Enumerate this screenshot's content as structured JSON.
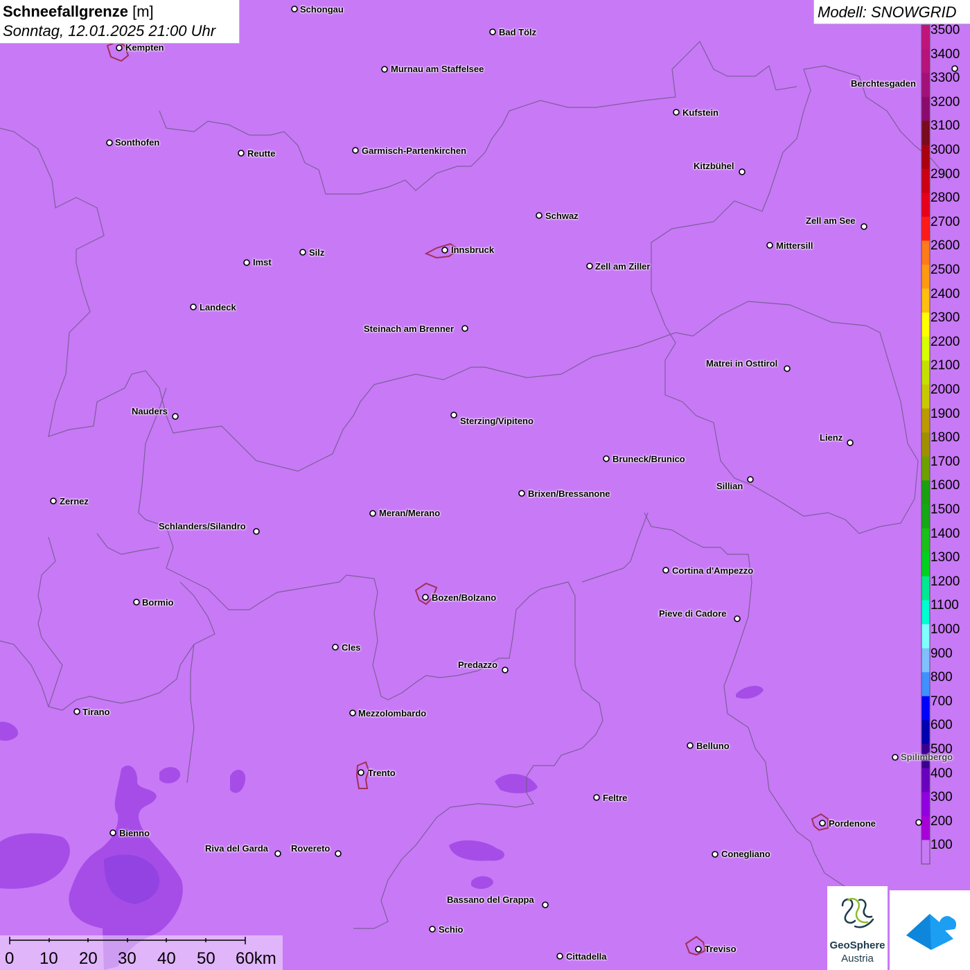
{
  "title": {
    "variable": "Schneefallgrenze",
    "unit": "[m]",
    "datetime": "Sonntag, 12.01.2025 21:00 Uhr"
  },
  "model": "Modell: SNOWGRID",
  "colors": {
    "background": "#c879f6",
    "low_snowline": "#a64de8",
    "lowest_snowline": "#8a3fe0",
    "city_boundary": "#a0305a"
  },
  "legend": {
    "labels": [
      "3500",
      "3400",
      "3300",
      "3200",
      "3100",
      "3000",
      "2900",
      "2800",
      "2700",
      "2600",
      "2500",
      "2400",
      "2300",
      "2200",
      "2100",
      "2000",
      "1900",
      "1800",
      "1700",
      "1600",
      "1500",
      "1400",
      "1300",
      "1200",
      "1100",
      "1000",
      "900",
      "800",
      "700",
      "600",
      "500",
      "400",
      "300",
      "200",
      "100"
    ],
    "colors": [
      "#c0147a",
      "#b8127c",
      "#a4107a",
      "#8c0a6e",
      "#7a0a1e",
      "#aa0010",
      "#cc0012",
      "#e8001a",
      "#ff1a1a",
      "#ff7a1a",
      "#ff9a10",
      "#ffbe10",
      "#ffff00",
      "#d8ff00",
      "#c4e000",
      "#c8c800",
      "#bc9a00",
      "#a09000",
      "#6ea000",
      "#1aa010",
      "#14a814",
      "#18c018",
      "#00d020",
      "#00e890",
      "#00ffd0",
      "#80ffff",
      "#80c0ff",
      "#4090ff",
      "#0000ff",
      "#0000b0",
      "#3a0090",
      "#6a00c0",
      "#9000e0",
      "#a800d8",
      "#c879f6"
    ]
  },
  "cities": [
    {
      "name": "Schongau"
    },
    {
      "name": "Kempten"
    },
    {
      "name": "Bad Tölz"
    },
    {
      "name": "Murnau am Staffelsee"
    },
    {
      "name": "Berchtesgaden"
    },
    {
      "name": "Kufstein"
    },
    {
      "name": "Sonthofen"
    },
    {
      "name": "Reutte"
    },
    {
      "name": "Garmisch-Partenkirchen"
    },
    {
      "name": "Kitzbühel"
    },
    {
      "name": "Schwaz"
    },
    {
      "name": "Zell am See"
    },
    {
      "name": "Mittersill"
    },
    {
      "name": "Innsbruck"
    },
    {
      "name": "Imst"
    },
    {
      "name": "Silz"
    },
    {
      "name": "Zell am Ziller"
    },
    {
      "name": "Landeck"
    },
    {
      "name": "Steinach am Brenner"
    },
    {
      "name": "Matrei in Osttirol"
    },
    {
      "name": "Nauders"
    },
    {
      "name": "Sterzing/Vipiteno"
    },
    {
      "name": "Lienz"
    },
    {
      "name": "Bruneck/Brunico"
    },
    {
      "name": "Sillian"
    },
    {
      "name": "Zernez"
    },
    {
      "name": "Brixen/Bressanone"
    },
    {
      "name": "Meran/Merano"
    },
    {
      "name": "Schlanders/Silandro"
    },
    {
      "name": "Cortina d'Ampezzo"
    },
    {
      "name": "Bozen/Bolzano"
    },
    {
      "name": "Bormio"
    },
    {
      "name": "Pieve di Cadore"
    },
    {
      "name": "Cles"
    },
    {
      "name": "Predazzo"
    },
    {
      "name": "Tirano"
    },
    {
      "name": "Mezzolombardo"
    },
    {
      "name": "Belluno"
    },
    {
      "name": "Spilimbergo"
    },
    {
      "name": "Trento"
    },
    {
      "name": "Feltre"
    },
    {
      "name": "Pordenone"
    },
    {
      "name": "Bienno"
    },
    {
      "name": "Riva del Garda"
    },
    {
      "name": "Rovereto"
    },
    {
      "name": "Conegliano"
    },
    {
      "name": "Bassano del Grappa"
    },
    {
      "name": "Schio"
    },
    {
      "name": "Treviso"
    },
    {
      "name": "Cittadella"
    }
  ],
  "scalebar": {
    "ticks": [
      "0",
      "10",
      "20",
      "30",
      "40",
      "50",
      "60km"
    ]
  },
  "logos": {
    "geosphere_line1": "GeoSphere",
    "geosphere_line2": "Austria",
    "geosphere_icon": "geosphere-logo-icon",
    "app_icon": "snow-cloud-icon"
  }
}
